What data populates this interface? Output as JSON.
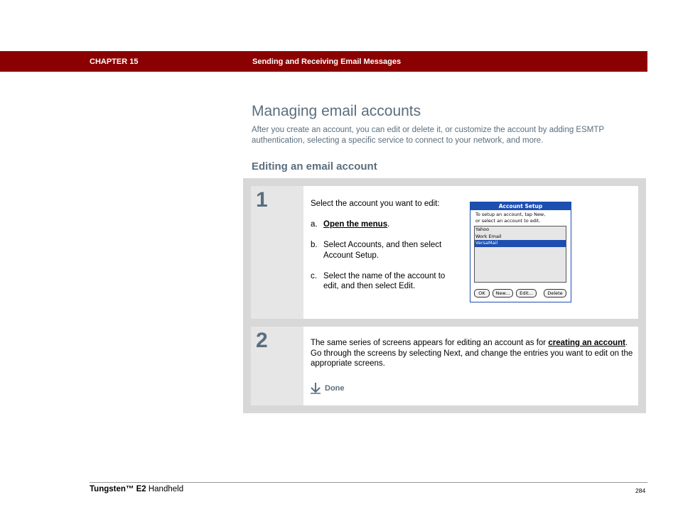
{
  "header": {
    "chapter": "CHAPTER 15",
    "chapter_title": "Sending and Receiving Email Messages",
    "bar_color": "#8b0000"
  },
  "section": {
    "title": "Managing email accounts",
    "intro": "After you create an account, you can edit or delete it, or customize the account by adding ESMTP authentication, selecting a specific service to connect to your network, and more.",
    "subheading": "Editing an email account"
  },
  "steps": [
    {
      "number": "1",
      "lead": "Select the account you want to edit:",
      "items": [
        {
          "letter": "a.",
          "link": "Open the menus",
          "rest": "."
        },
        {
          "letter": "b.",
          "text": "Select Accounts, and then select Account Setup."
        },
        {
          "letter": "c.",
          "text": "Select the name of the account to edit, and then select Edit."
        }
      ]
    },
    {
      "number": "2",
      "text_before": "The same series of screens appears for editing an account as for ",
      "link": "creating an account",
      "text_after": ". Go through the screens by selecting Next, and change the entries you want to edit on the appropriate screens.",
      "done_label": "Done",
      "done_icon": "down-arrow-icon"
    }
  ],
  "palm_screen": {
    "title": "Account Setup",
    "instruction_line1": "To setup an account, tap New,",
    "instruction_line2": "or select an account to edit.",
    "accounts": [
      "Yahoo",
      "Work Email",
      "VersaMail"
    ],
    "selected": "VersaMail",
    "buttons": {
      "ok": "OK",
      "new": "New...",
      "edit": "Edit...",
      "delete": "Delete"
    },
    "accent": "#1c4fb0"
  },
  "footer": {
    "brand": "Tungsten™ E2",
    "product": " Handheld",
    "page": "284"
  }
}
